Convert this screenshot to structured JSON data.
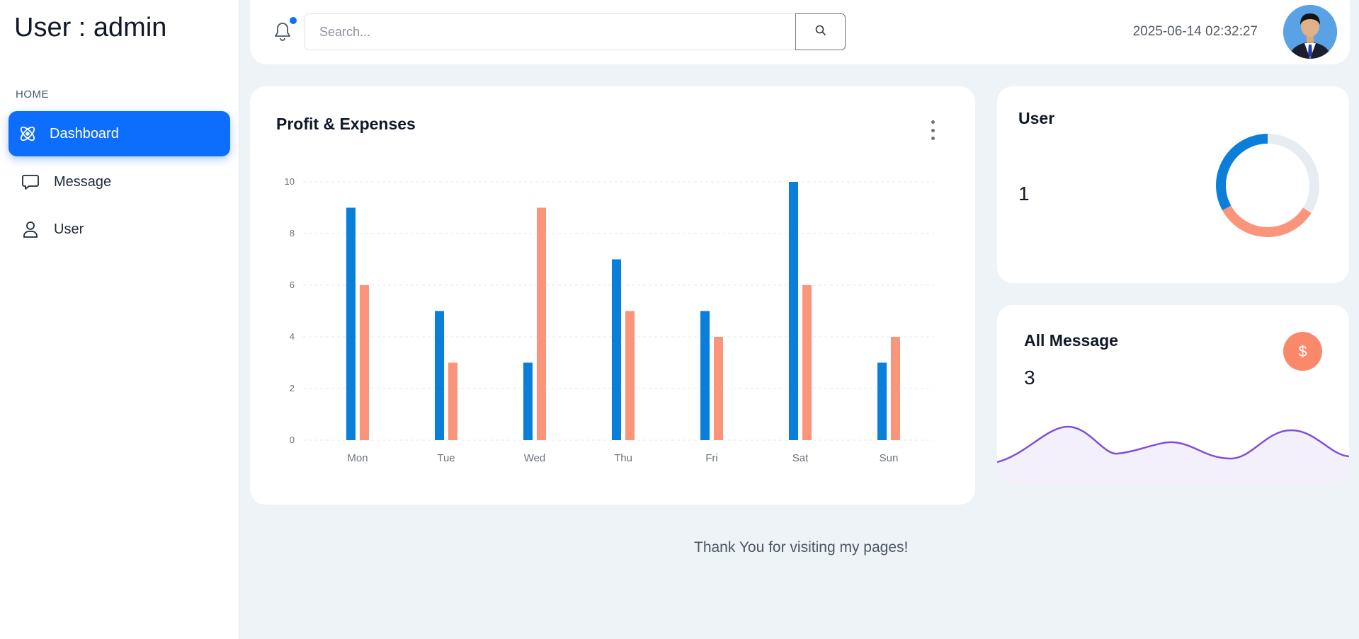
{
  "sidebar": {
    "brand": "User : admin",
    "section_label": "HOME",
    "items": [
      {
        "label": "Dashboard",
        "icon": "atom-icon",
        "active": true
      },
      {
        "label": "Message",
        "icon": "chat-bubble-icon",
        "active": false
      },
      {
        "label": "User",
        "icon": "user-icon",
        "active": false
      }
    ]
  },
  "topbar": {
    "search_placeholder": "Search...",
    "datetime": "2025-06-14 02:32:27",
    "notification_dot_color": "#0d6efd"
  },
  "profit_card": {
    "title": "Profit & Expenses"
  },
  "chart_data": {
    "type": "bar",
    "title": "Profit & Expenses",
    "categories": [
      "Mon",
      "Tue",
      "Wed",
      "Thu",
      "Fri",
      "Sat",
      "Sun"
    ],
    "series": [
      {
        "values": [
          9,
          5,
          3,
          7,
          5,
          10,
          3
        ],
        "color": "#0a7fd9"
      },
      {
        "values": [
          6,
          3,
          9,
          5,
          4,
          6,
          4
        ],
        "color": "#fa957b"
      }
    ],
    "ylim": [
      0,
      10
    ],
    "yticks": [
      "0",
      "2",
      "4",
      "6",
      "8",
      "10"
    ],
    "grid": true
  },
  "user_card": {
    "title": "User",
    "count": "1",
    "donut": {
      "segments": [
        0.33,
        0.33,
        0.34
      ],
      "colors": [
        "#0a7fd9",
        "#fa957b",
        "#e6ecf2"
      ]
    }
  },
  "message_card": {
    "title": "All Message",
    "count": "3",
    "badge_symbol": "$",
    "sparkline_color": "#7f4fd6"
  },
  "footer": {
    "text": "Thank You for visiting my pages!"
  }
}
